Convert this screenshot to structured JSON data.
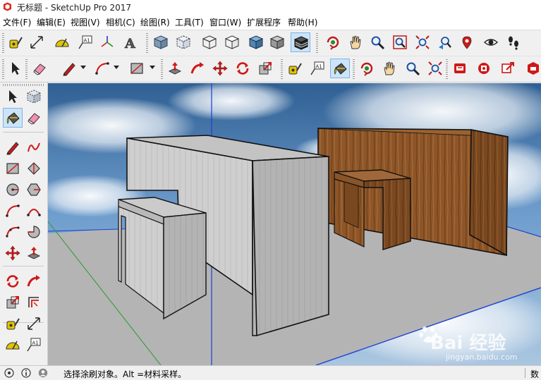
{
  "window": {
    "title": "无标题 - SketchUp Pro 2017"
  },
  "menu": [
    "文件(F)",
    "编辑(E)",
    "视图(V)",
    "相机(C)",
    "绘图(R)",
    "工具(T)",
    "窗口(W)",
    "扩展程序",
    "帮助(H)"
  ],
  "toolbar_row1": [
    {
      "name": "tape-measure-icon",
      "kind": "tape"
    },
    {
      "name": "dimension-icon",
      "kind": "dim"
    },
    {
      "name": "protractor-icon",
      "kind": "prot"
    },
    {
      "name": "text-label-icon",
      "kind": "text",
      "label": "A1"
    },
    {
      "name": "axes-icon",
      "kind": "axes"
    },
    {
      "name": "3d-text-icon",
      "kind": "text3d",
      "label": "A"
    },
    {
      "name": "xray-style-icon",
      "kind": "cube_xray"
    },
    {
      "name": "back-edges-style-icon",
      "kind": "cube_back"
    },
    {
      "name": "wireframe-style-icon",
      "kind": "cube_wire"
    },
    {
      "name": "hidden-line-style-icon",
      "kind": "cube_hidden"
    },
    {
      "name": "shaded-style-icon",
      "kind": "cube_shaded"
    },
    {
      "name": "shaded-textures-style-icon",
      "kind": "cube_tex",
      "selected": true
    },
    {
      "name": "monochrome-style-icon",
      "kind": "cube_mono"
    },
    {
      "name": "orbit-icon",
      "kind": "orbit"
    },
    {
      "name": "pan-hand-icon",
      "kind": "hand"
    },
    {
      "name": "zoom-icon",
      "kind": "zoom"
    },
    {
      "name": "zoom-window-icon",
      "kind": "zoomwin"
    },
    {
      "name": "zoom-extents-icon",
      "kind": "zoomext"
    },
    {
      "name": "previous-view-icon",
      "kind": "prev"
    },
    {
      "name": "position-camera-icon",
      "kind": "poscam"
    },
    {
      "name": "look-around-icon",
      "kind": "eye"
    },
    {
      "name": "walk-icon",
      "kind": "walk"
    }
  ],
  "toolbar_row2": [
    {
      "name": "select-arrow-icon",
      "kind": "arrow"
    },
    {
      "name": "eraser-icon",
      "kind": "eraser"
    },
    {
      "name": "pencil-line-icon",
      "kind": "pencil",
      "dropdown": true
    },
    {
      "name": "arc-icon",
      "kind": "arc",
      "dropdown": true
    },
    {
      "name": "rectangle-icon",
      "kind": "rect",
      "dropdown": true
    },
    {
      "name": "push-pull-icon",
      "kind": "pushpull"
    },
    {
      "name": "follow-me-icon",
      "kind": "followme"
    },
    {
      "name": "move-icon",
      "kind": "move"
    },
    {
      "name": "rotate-icon",
      "kind": "rotate"
    },
    {
      "name": "scale-icon",
      "kind": "scale"
    },
    {
      "name": "tape-measure-icon",
      "kind": "tape"
    },
    {
      "name": "text-label-icon",
      "kind": "text",
      "label": "A1"
    },
    {
      "name": "paint-bucket-icon",
      "kind": "bucket",
      "selected": true
    },
    {
      "name": "orbit-icon",
      "kind": "orbit"
    },
    {
      "name": "pan-hand-icon",
      "kind": "hand"
    },
    {
      "name": "zoom-icon",
      "kind": "zoom"
    },
    {
      "name": "zoom-extents-icon",
      "kind": "zoomext"
    },
    {
      "name": "warehouse-icon",
      "kind": "warehouse"
    },
    {
      "name": "extension-warehouse-icon",
      "kind": "extwh"
    },
    {
      "name": "share-model-icon",
      "kind": "share"
    },
    {
      "name": "layout-send-icon",
      "kind": "layout"
    }
  ],
  "left_toolbar": [
    {
      "name": "select-arrow-icon",
      "kind": "arrow"
    },
    {
      "name": "make-component-icon",
      "kind": "component"
    },
    {
      "name": "paint-bucket-icon",
      "kind": "bucket",
      "selected": true
    },
    {
      "name": "eraser-icon",
      "kind": "eraser"
    },
    {
      "name": "pencil-line-icon",
      "kind": "pencil"
    },
    {
      "name": "freehand-icon",
      "kind": "freehand"
    },
    {
      "name": "rectangle-icon",
      "kind": "rect"
    },
    {
      "name": "rotated-rectangle-icon",
      "kind": "rotrect"
    },
    {
      "name": "circle-icon",
      "kind": "circle"
    },
    {
      "name": "polygon-icon",
      "kind": "polygon"
    },
    {
      "name": "arc-icon",
      "kind": "arc"
    },
    {
      "name": "two-point-arc-icon",
      "kind": "arc2"
    },
    {
      "name": "three-point-arc-icon",
      "kind": "arc3"
    },
    {
      "name": "pie-icon",
      "kind": "pie"
    },
    {
      "name": "move-icon",
      "kind": "move"
    },
    {
      "name": "push-pull-icon",
      "kind": "pushpull"
    },
    {
      "name": "rotate-icon",
      "kind": "rotate"
    },
    {
      "name": "follow-me-icon",
      "kind": "followme"
    },
    {
      "name": "scale-icon",
      "kind": "scale"
    },
    {
      "name": "offset-icon",
      "kind": "offset"
    },
    {
      "name": "tape-measure-icon",
      "kind": "tape"
    },
    {
      "name": "dimension-icon",
      "kind": "dim"
    },
    {
      "name": "protractor-icon",
      "kind": "prot"
    },
    {
      "name": "text-label-icon",
      "kind": "text",
      "label": "A1"
    }
  ],
  "watermark": {
    "text": "Bai 经验",
    "subtext": "jingyan.baidu.com"
  },
  "status": {
    "message": "选择涂刷对象。Alt =材料采样。",
    "measurements_label": "数"
  },
  "colors": {
    "sky": "#5d8fbe",
    "ground": "#b5b5b5",
    "wood": "#8a5428",
    "box": "#c9c9c9",
    "selection": "#cce4f7"
  }
}
